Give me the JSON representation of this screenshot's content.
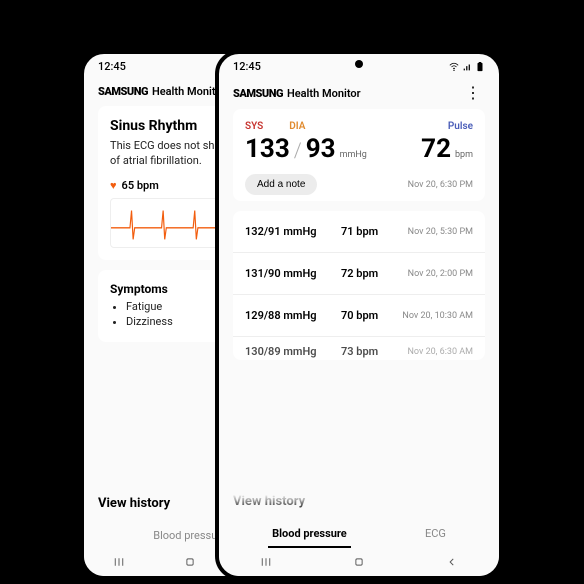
{
  "status": {
    "time": "12:45"
  },
  "app": {
    "brand": "SAMSUNG",
    "name": "Health Monitor"
  },
  "ecg": {
    "title": "Sinus Rhythm",
    "description": "This ECG does not show signs of atrial fibrillation.",
    "bpm": "65 bpm",
    "symptoms_heading": "Symptoms",
    "symptoms": [
      "Fatigue",
      "Dizziness"
    ]
  },
  "bp": {
    "labels": {
      "sys": "SYS",
      "dia": "DIA",
      "pulse": "Pulse"
    },
    "sys": "133",
    "dia": "93",
    "unit": "mmHg",
    "pulse": "72",
    "pulse_unit": "bpm",
    "add_note": "Add a note",
    "timestamp": "Nov 20, 6:30 PM",
    "history": [
      {
        "bp": "132/91 mmHg",
        "pulse": "71 bpm",
        "time": "Nov 20, 5:30 PM"
      },
      {
        "bp": "131/90 mmHg",
        "pulse": "72 bpm",
        "time": "Nov 20, 2:00 PM"
      },
      {
        "bp": "129/88 mmHg",
        "pulse": "70 bpm",
        "time": "Nov 20, 10:30 AM"
      },
      {
        "bp": "130/89 mmHg",
        "pulse": "73 bpm",
        "time": "Nov 20, 6:30 AM"
      }
    ]
  },
  "footer": {
    "view_history": "View history",
    "tab_bp": "Blood pressure",
    "tab_ecg": "ECG"
  }
}
